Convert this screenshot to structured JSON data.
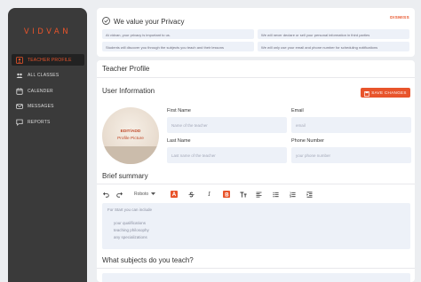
{
  "sidebar": {
    "brand": "VIDVAN",
    "items": [
      {
        "label": "TEACHER PROFILE",
        "icon": "person-icon"
      },
      {
        "label": "ALL CLASSES",
        "icon": "group-icon"
      },
      {
        "label": "CALENDER",
        "icon": "calendar-icon"
      },
      {
        "label": "MESSAGES",
        "icon": "mail-icon"
      },
      {
        "label": "REPORTS",
        "icon": "chat-icon"
      }
    ]
  },
  "privacy": {
    "title": "We value your Privacy",
    "dismiss": "DISMISS",
    "notes": [
      "At vidvan, your privacy is important to us.",
      "We will never declare or sell your personal information in third parties",
      "Students will discover you through the subjects you teach and their lessons",
      "We will only use your email and phone number for scheduling notifications"
    ]
  },
  "profile": {
    "title": "Teacher Profile",
    "user_info_title": "User Information",
    "save_label": "SAVE CHANGES",
    "avatar_edit": "EDIT/ADD",
    "avatar_sub": "Profile Picture",
    "first_name_label": "First Name",
    "first_name_placeholder": "Name of the teacher",
    "email_label": "Email",
    "email_placeholder": "email",
    "last_name_label": "Last Name",
    "last_name_placeholder": "Last name of the teacher",
    "phone_label": "Phone Number",
    "phone_placeholder": "your phone number",
    "brief_title": "Brief summary",
    "font_select": "Roboto",
    "editor_intro": "For Start you can include",
    "editor_items": [
      "your qualifications",
      "teaching philosophy",
      "any specializations"
    ],
    "subjects_title": "What subjects do you teach?"
  },
  "colors": {
    "accent": "#e8542b",
    "sidebar": "#3a3a3a",
    "field": "#edf1f8"
  }
}
